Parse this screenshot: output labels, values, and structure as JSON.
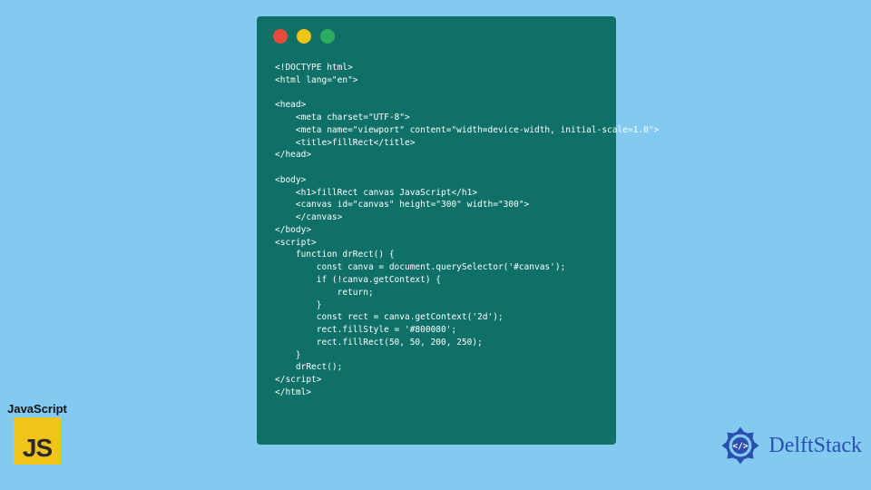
{
  "window": {
    "dots": {
      "red": "#e84b3c",
      "yellow": "#f0c41b",
      "green": "#2bae60"
    },
    "bg": "#0e7067"
  },
  "code": "<!DOCTYPE html>\n<html lang=\"en\">\n\n<head>\n    <meta charset=\"UTF-8\">\n    <meta name=\"viewport\" content=\"width=device-width, initial-scale=1.0\">\n    <title>fillRect</title>\n</head>\n\n<body>\n    <h1>fillRect canvas JavaScript</h1>\n    <canvas id=\"canvas\" height=\"300\" width=\"300\">\n    </canvas>\n</body>\n<script>\n    function drRect() {\n        const canva = document.querySelector('#canvas');\n        if (!canva.getContext) {\n            return;\n        }\n        const rect = canva.getContext('2d');\n        rect.fillStyle = '#800080';\n        rect.fillRect(50, 50, 200, 250);\n    }\n    drRect();\n</script>\n</html>",
  "js_badge": {
    "label": "JavaScript",
    "logo_text": "JS"
  },
  "delft": {
    "text": "DelftStack"
  }
}
